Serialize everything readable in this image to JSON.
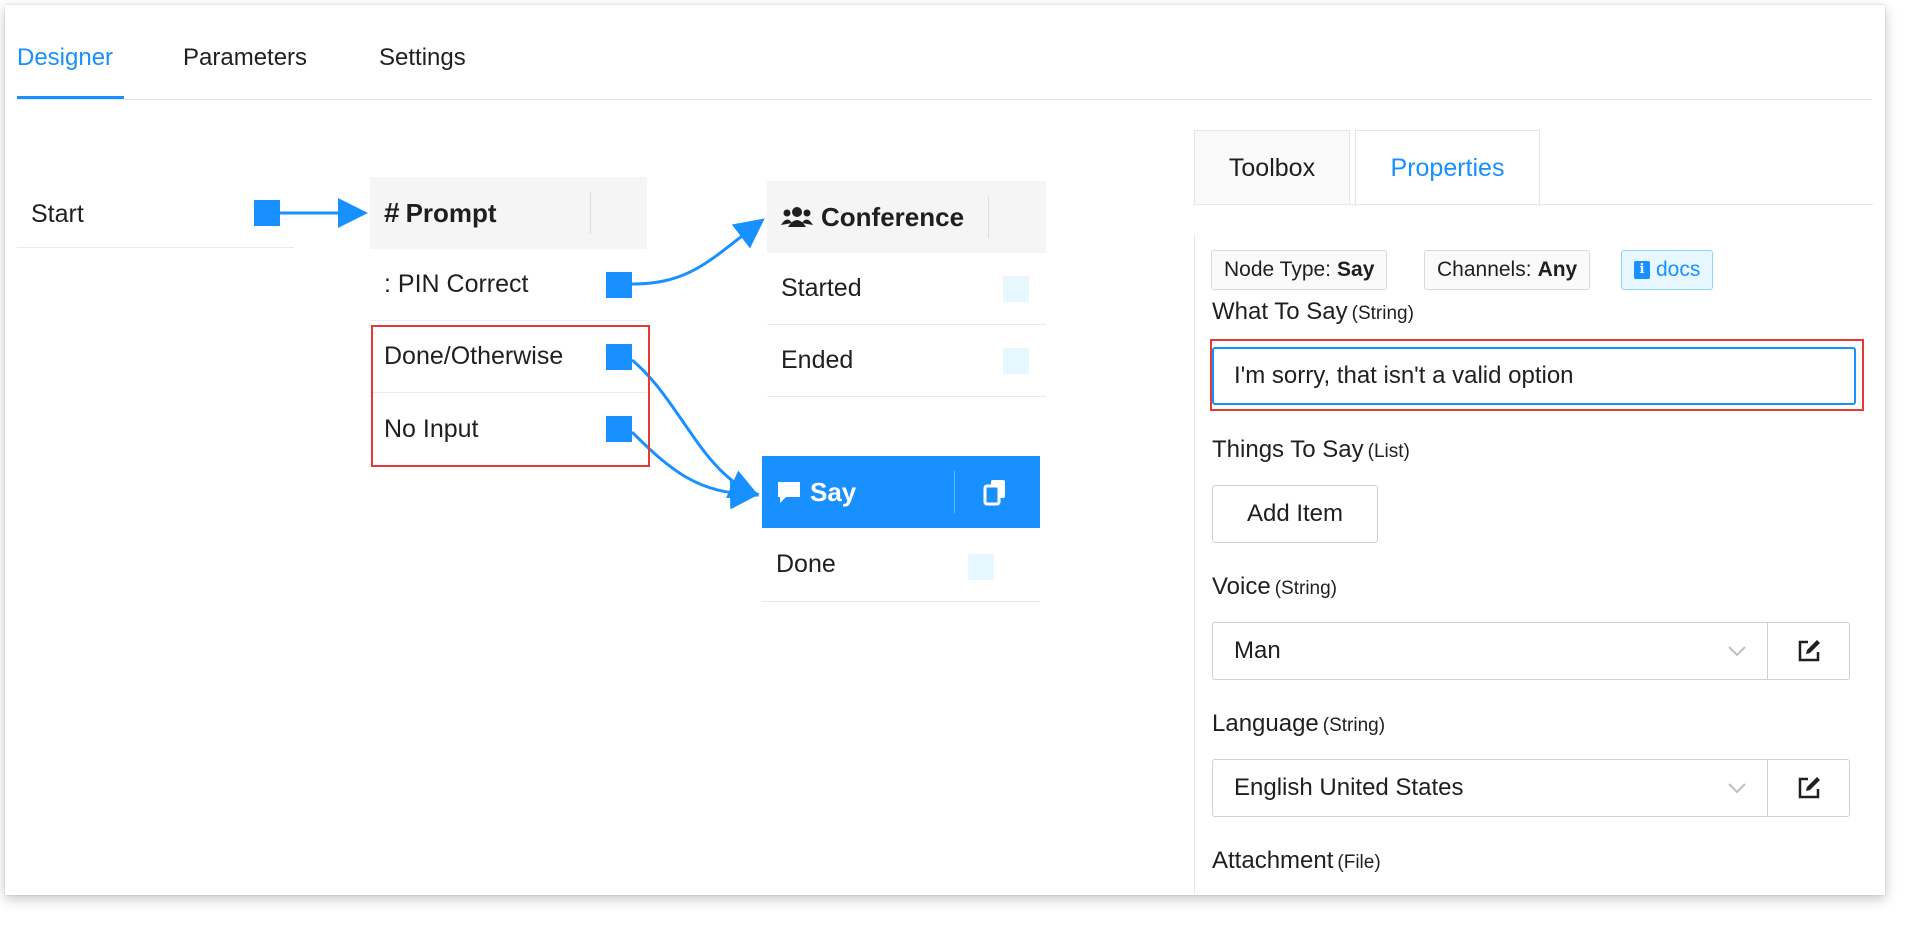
{
  "tabs": [
    {
      "label": "Designer",
      "active": true
    },
    {
      "label": "Parameters",
      "active": false
    },
    {
      "label": "Settings",
      "active": false
    }
  ],
  "flow": {
    "start": {
      "label": "Start"
    },
    "prompt": {
      "title": "Prompt",
      "title_icon": "hash-icon",
      "rows": [
        ": PIN Correct",
        "Done/Otherwise",
        "No Input"
      ]
    },
    "conference": {
      "title": "Conference",
      "title_icon": "users-icon",
      "rows": [
        "Started",
        "Ended"
      ]
    },
    "say": {
      "title": "Say",
      "title_icon": "comment-icon",
      "action_icon": "copy-icon",
      "rows": [
        "Done"
      ]
    }
  },
  "right_panel": {
    "tabs": [
      {
        "label": "Toolbox",
        "active": false
      },
      {
        "label": "Properties",
        "active": true
      }
    ],
    "badges": {
      "node_type_label": "Node Type:",
      "node_type_value": "Say",
      "channels_label": "Channels:",
      "channels_value": "Any",
      "docs_label": "docs"
    },
    "what_to_say": {
      "label": "What To Say",
      "type": "(String)",
      "value": "I'm sorry, that isn't a valid option"
    },
    "things_to_say": {
      "label": "Things To Say",
      "type": "(List)",
      "button": "Add Item"
    },
    "voice": {
      "label": "Voice",
      "type": "(String)",
      "value": "Man"
    },
    "language": {
      "label": "Language",
      "type": "(String)",
      "value": "English United States"
    },
    "attachment": {
      "label": "Attachment",
      "type": "(File)"
    }
  },
  "colors": {
    "accent": "#1890ff",
    "highlight_box": "#e53935",
    "port_inactive": "#e6f7ff"
  }
}
